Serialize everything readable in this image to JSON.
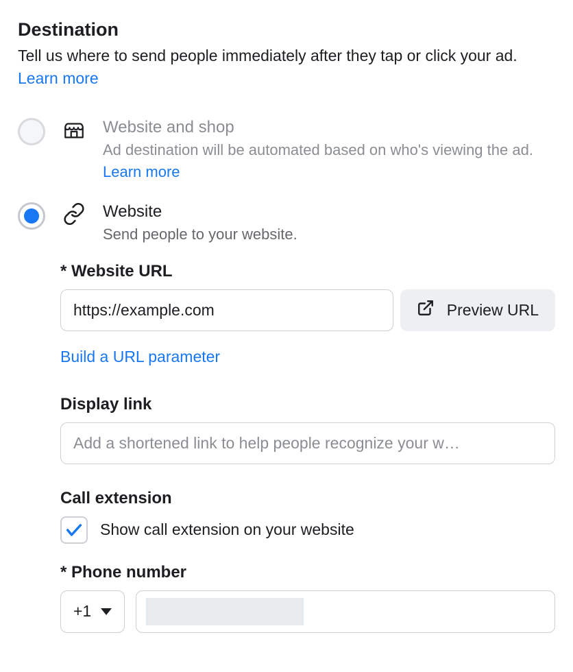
{
  "header": {
    "title": "Destination",
    "description": "Tell us where to send people immediately after they tap or click your ad. ",
    "learn_more": "Learn more"
  },
  "options": {
    "website_shop": {
      "title": "Website and shop",
      "desc_pre": "Ad destination will be automated based on who's viewing the ad. ",
      "learn_more": "Learn more"
    },
    "website": {
      "title": "Website",
      "desc": "Send people to your website."
    }
  },
  "website_url": {
    "label": "* Website URL",
    "value": "https://example.com",
    "preview": "Preview URL",
    "build_link": "Build a URL parameter"
  },
  "display_link": {
    "label": "Display link",
    "placeholder": "Add a shortened link to help people recognize your w…"
  },
  "call_ext": {
    "label": "Call extension",
    "checkbox_label": "Show call extension on your website"
  },
  "phone": {
    "label": "* Phone number",
    "code": "+1"
  }
}
